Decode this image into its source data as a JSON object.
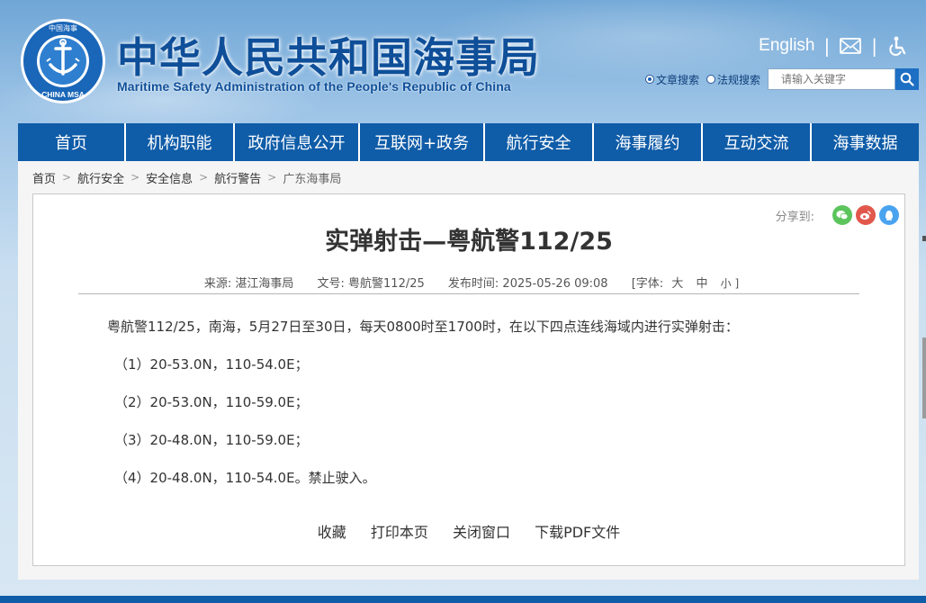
{
  "header": {
    "title_cn": "中华人民共和国海事局",
    "title_en": "Maritime Safety Administration of the People's Republic of China",
    "logo": {
      "icon": "china-msa-emblem-icon",
      "text_top": "中国海事",
      "text_bottom": "CHINA MSA"
    },
    "english_link": "English",
    "mail_icon": "mail-icon",
    "accessibility_icon": "accessibility-icon"
  },
  "search": {
    "option_article": "文章搜索",
    "option_law": "法规搜索",
    "selected": "文章搜索",
    "placeholder": "请输入关键字",
    "button_icon": "search-icon"
  },
  "nav": {
    "items": [
      {
        "label": "首页"
      },
      {
        "label": "机构职能"
      },
      {
        "label": "政府信息公开"
      },
      {
        "label": "互联网+政务"
      },
      {
        "label": "航行安全"
      },
      {
        "label": "海事履约"
      },
      {
        "label": "互动交流"
      },
      {
        "label": "海事数据"
      }
    ]
  },
  "breadcrumb": [
    "首页",
    "航行安全",
    "安全信息",
    "航行警告",
    "广东海事局"
  ],
  "article": {
    "share_label": "分享到:",
    "share_icons": [
      "wechat-icon",
      "weibo-icon",
      "qq-icon"
    ],
    "title": "实弹射击—粤航警112/25",
    "meta": {
      "source": "来源: 湛江海事局",
      "doc_no": "文号: 粤航警112/25",
      "published": "发布时间: 2025-05-26 09:08",
      "font_label": "[字体:",
      "font_large": "大",
      "font_medium": "中",
      "font_small": "小 ]"
    },
    "paragraphs": [
      "粤航警112/25，南海，5月27日至30日，每天0800时至1700时，在以下四点连线海域内进行实弹射击：",
      "（1）20-53.0N，110-54.0E；",
      "（2）20-53.0N，110-59.0E；",
      "（3）20-48.0N，110-59.0E；",
      "（4）20-48.0N，110-54.0E。禁止驶入。"
    ],
    "actions": {
      "favorite": "收藏",
      "print": "打印本页",
      "close": "关闭窗口",
      "download_pdf": "下载PDF文件"
    }
  },
  "colors": {
    "brand_blue": "#0f5ca8",
    "title_blue": "#0f4f99",
    "wechat_green": "#5cc45c",
    "weibo_red": "#e2574c",
    "qq_blue": "#4aa3ef"
  }
}
